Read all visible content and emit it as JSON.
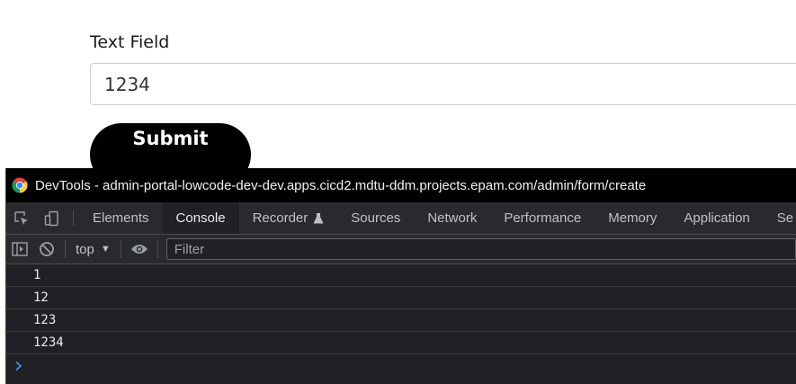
{
  "form": {
    "label": "Text Field",
    "input_value": "1234",
    "submit_label": "Submit"
  },
  "devtools": {
    "title": "DevTools - admin-portal-lowcode-dev-dev.apps.cicd2.mdtu-ddm.projects.epam.com/admin/form/create",
    "tabs": [
      {
        "label": "Elements"
      },
      {
        "label": "Console",
        "active": true
      },
      {
        "label": "Recorder"
      },
      {
        "label": "Sources"
      },
      {
        "label": "Network"
      },
      {
        "label": "Performance"
      },
      {
        "label": "Memory"
      },
      {
        "label": "Application"
      },
      {
        "label": "Se"
      }
    ],
    "context": "top",
    "filter_placeholder": "Filter",
    "logs": [
      "1",
      "12",
      "123",
      "1234"
    ],
    "colors": {
      "panel_bg": "#202124",
      "toolbar_bg": "#292a2d",
      "prompt": "#4a8cf7"
    }
  }
}
